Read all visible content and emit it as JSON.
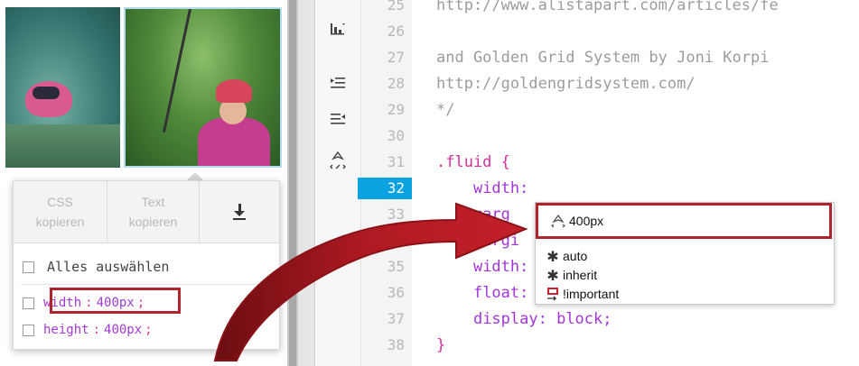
{
  "left_panel": {
    "toolbar": {
      "css_copy": [
        "CSS",
        "kopieren"
      ],
      "text_copy": [
        "Text",
        "kopieren"
      ],
      "download_icon": "download-icon"
    },
    "select_all_label": "Alles auswählen",
    "properties": [
      {
        "name": "width",
        "colon": ":",
        "value": "400px",
        "semicolon": ";"
      },
      {
        "name": "height",
        "colon": ":",
        "value": "400px",
        "semicolon": ";"
      }
    ]
  },
  "editor": {
    "lines": [
      {
        "num": "25",
        "text": "http://www.alistapart.com/articles/fe"
      },
      {
        "num": "26",
        "text": ""
      },
      {
        "num": "27",
        "text": "and Golden Grid System by Joni Korpi"
      },
      {
        "num": "28",
        "text": "http://goldengridsystem.com/"
      },
      {
        "num": "29",
        "text": "*/"
      },
      {
        "num": "30",
        "text": ""
      },
      {
        "num": "31",
        "selector": ".fluid",
        "brace": " {"
      },
      {
        "num": "32",
        "prop": "width",
        "rest": ":"
      },
      {
        "num": "33",
        "prop": "marg",
        "rest": ""
      },
      {
        "num": "34",
        "prop": "margi",
        "rest": ""
      },
      {
        "num": "35",
        "prop": "width",
        "rest": ":"
      },
      {
        "num": "36",
        "prop": "float",
        "rest": ":"
      },
      {
        "num": "37",
        "prop": "display",
        "rest": ": block;"
      },
      {
        "num": "38",
        "brace_only": "}"
      }
    ],
    "active_line": "32"
  },
  "autocomplete": {
    "selected": "400px",
    "items": [
      {
        "label": "auto",
        "icon": "asterisk-icon"
      },
      {
        "label": "inherit",
        "icon": "asterisk-icon"
      },
      {
        "label": "!important",
        "icon": "important-icon"
      }
    ]
  },
  "colors": {
    "accent_red": "#b0252d",
    "active_line_blue": "#0aa2e0",
    "selector_pink": "#d8309b",
    "property_purple": "#a336d8"
  }
}
